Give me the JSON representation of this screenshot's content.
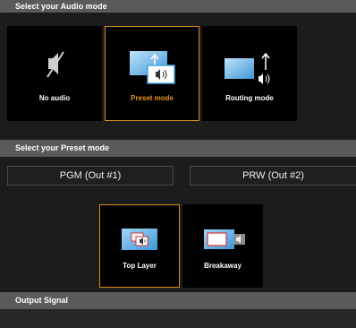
{
  "audio_section": {
    "title": "Select your Audio mode"
  },
  "audio_modes": [
    {
      "label": "No audio",
      "icon": "speaker-muted-icon",
      "selected": false
    },
    {
      "label": "Preset mode",
      "icon": "preset-screen-icon",
      "selected": true
    },
    {
      "label": "Routing mode",
      "icon": "routing-screen-icon",
      "selected": false
    }
  ],
  "preset_section": {
    "title": "Select your Preset mode",
    "outputs": [
      "PGM (Out #1)",
      "PRW (Out #2)"
    ]
  },
  "layer_modes": [
    {
      "label": "Top Layer",
      "icon": "top-layer-icon",
      "selected": true
    },
    {
      "label": "Breakaway",
      "icon": "breakaway-icon",
      "selected": false
    }
  ],
  "output_section": {
    "title": "Output Signal"
  },
  "colors": {
    "accent": "#e8931f",
    "header_bg": "#5a5a5a",
    "panel_bg": "#1c1c1c",
    "screen_blue": "#4aa6df"
  }
}
